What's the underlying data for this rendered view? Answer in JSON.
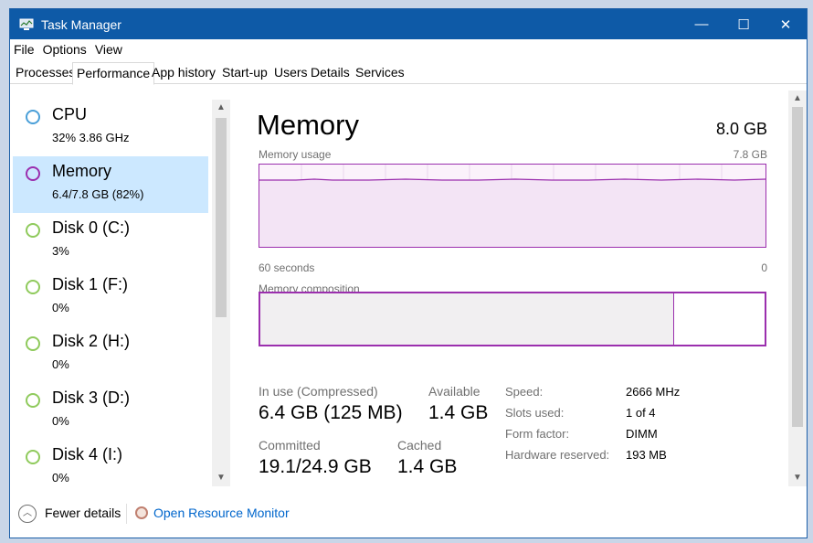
{
  "window": {
    "title": "Task Manager",
    "controls": {
      "minimize": "—",
      "maximize": "☐",
      "close": "✕"
    }
  },
  "menu": [
    "File",
    "Options",
    "View"
  ],
  "tabs": [
    {
      "label": "Processes",
      "active": false
    },
    {
      "label": "Performance",
      "active": true
    },
    {
      "label": "App history",
      "active": false
    },
    {
      "label": "Start-up",
      "active": false
    },
    {
      "label": "Users",
      "active": false
    },
    {
      "label": "Details",
      "active": false
    },
    {
      "label": "Services",
      "active": false
    }
  ],
  "sidebar": {
    "items": [
      {
        "name": "CPU",
        "sub": "32%  3.86 GHz",
        "color": "#4a9fd8",
        "selected": false
      },
      {
        "name": "Memory",
        "sub": "6.4/7.8 GB (82%)",
        "color": "#9b2fae",
        "selected": true
      },
      {
        "name": "Disk 0 (C:)",
        "sub": "3%",
        "color": "#8fca5c",
        "selected": false
      },
      {
        "name": "Disk 1 (F:)",
        "sub": "0%",
        "color": "#8fca5c",
        "selected": false
      },
      {
        "name": "Disk 2 (H:)",
        "sub": "0%",
        "color": "#8fca5c",
        "selected": false
      },
      {
        "name": "Disk 3 (D:)",
        "sub": "0%",
        "color": "#8fca5c",
        "selected": false
      },
      {
        "name": "Disk 4 (I:)",
        "sub": "0%",
        "color": "#8fca5c",
        "selected": false
      }
    ],
    "scroll_up": "▲",
    "scroll_down": "▼"
  },
  "main": {
    "title": "Memory",
    "total": "8.0 GB",
    "usage_label": "Memory usage",
    "usage_max": "7.8 GB",
    "time_left": "60 seconds",
    "time_right": "0",
    "composition_label": "Memory composition",
    "in_use_fraction": 0.82,
    "stats": {
      "in_use_label": "In use (Compressed)",
      "in_use_value": "6.4 GB (125 MB)",
      "available_label": "Available",
      "available_value": "1.4 GB",
      "committed_label": "Committed",
      "committed_value": "19.1/24.9 GB",
      "cached_label": "Cached",
      "cached_value": "1.4 GB"
    },
    "details": [
      {
        "label": "Speed:",
        "value": "2666 MHz"
      },
      {
        "label": "Slots used:",
        "value": "1 of 4"
      },
      {
        "label": "Form factor:",
        "value": "DIMM"
      },
      {
        "label": "Hardware reserved:",
        "value": "193 MB"
      }
    ]
  },
  "footer": {
    "fewer_details": "Fewer details",
    "fewer_icon": "︿",
    "resource_monitor": "Open Resource Monitor"
  },
  "colors": {
    "titlebar": "#0e5aa7",
    "memory_accent": "#9b2fae",
    "selected_bg": "#cce8ff",
    "link": "#0066cc"
  }
}
